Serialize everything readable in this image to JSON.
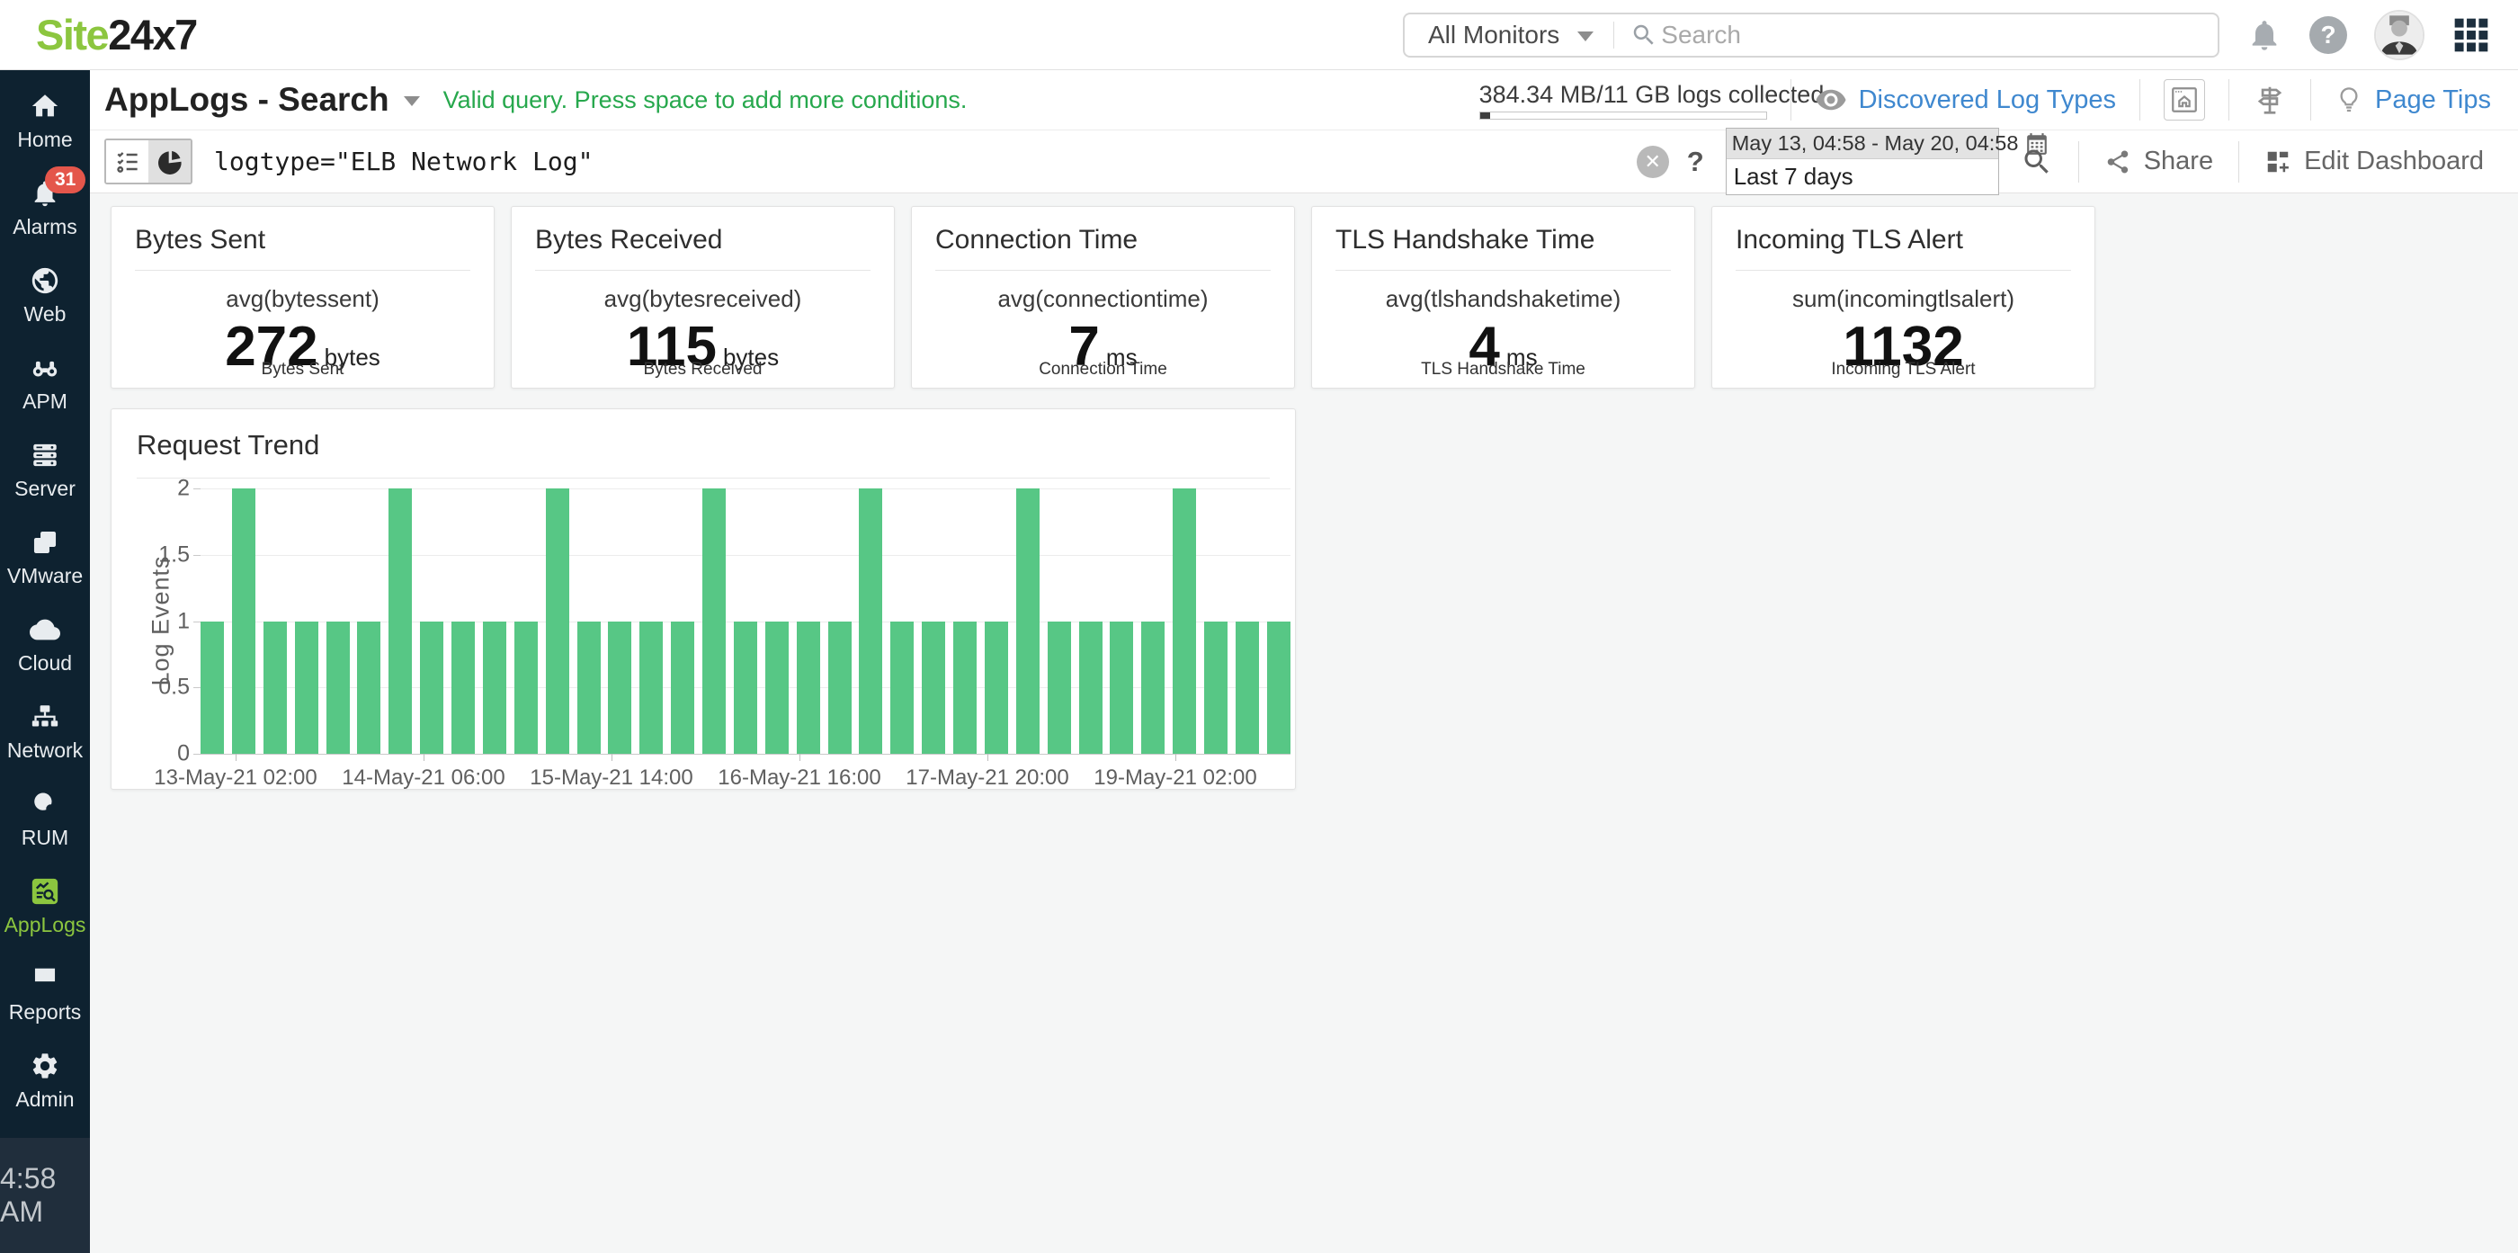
{
  "topbar": {
    "logo_part1": "Site",
    "logo_part2": "24x7",
    "monitor_dropdown": "All Monitors",
    "search_placeholder": "Search"
  },
  "sidebar": {
    "items": [
      {
        "label": "Home",
        "icon": "home"
      },
      {
        "label": "Alarms",
        "icon": "bell",
        "badge": "31"
      },
      {
        "label": "Web",
        "icon": "globe"
      },
      {
        "label": "APM",
        "icon": "binoculars"
      },
      {
        "label": "Server",
        "icon": "server"
      },
      {
        "label": "VMware",
        "icon": "vmware"
      },
      {
        "label": "Cloud",
        "icon": "cloud"
      },
      {
        "label": "Network",
        "icon": "network"
      },
      {
        "label": "RUM",
        "icon": "rum"
      },
      {
        "label": "AppLogs",
        "icon": "applogs",
        "active": true
      },
      {
        "label": "Reports",
        "icon": "reports"
      },
      {
        "label": "Admin",
        "icon": "admin"
      }
    ],
    "clock": "4:58 AM"
  },
  "header": {
    "title": "AppLogs - Search",
    "status_message": "Valid query. Press space to add more conditions.",
    "usage_text": "384.34 MB/11 GB logs collected",
    "usage_fill_percent": 3.5,
    "discovered_log_types": "Discovered Log Types",
    "page_tips": "Page Tips"
  },
  "querybar": {
    "query": "logtype=\"ELB Network Log\"",
    "clear_glyph": "✕",
    "help_glyph": "?",
    "date_range": "May 13, 04:58 - May 20, 04:58",
    "date_preset": "Last 7 days",
    "share_label": "Share",
    "edit_dashboard_label": "Edit Dashboard"
  },
  "cards": [
    {
      "title": "Bytes Sent",
      "metric": "avg(bytessent)",
      "value": "272",
      "unit": "bytes",
      "footer": "Bytes Sent"
    },
    {
      "title": "Bytes Received",
      "metric": "avg(bytesreceived)",
      "value": "115",
      "unit": "bytes",
      "footer": "Bytes Received"
    },
    {
      "title": "Connection Time",
      "metric": "avg(connectiontime)",
      "value": "7",
      "unit": "ms",
      "footer": "Connection Time"
    },
    {
      "title": "TLS Handshake Time",
      "metric": "avg(tlshandshaketime)",
      "value": "4",
      "unit": "ms",
      "footer": "TLS Handshake Time"
    },
    {
      "title": "Incoming TLS Alert",
      "metric": "sum(incomingtlsalert)",
      "value": "1132",
      "unit": "",
      "footer": "Incoming TLS Alert"
    }
  ],
  "chart_data": {
    "type": "bar",
    "title": "Request Trend",
    "ylabel": "Log Events",
    "ylim": [
      0,
      2
    ],
    "yticks": [
      0,
      0.5,
      1,
      1.5,
      2
    ],
    "grid": true,
    "legend": "none",
    "bar_color": "#57c785",
    "xtick_labels": [
      "13-May-21 02:00",
      "14-May-21 06:00",
      "15-May-21 14:00",
      "16-May-21 16:00",
      "17-May-21 20:00",
      "19-May-21 02:00"
    ],
    "values": [
      1,
      2,
      1,
      1,
      1,
      1,
      2,
      1,
      1,
      1,
      1,
      2,
      1,
      1,
      1,
      1,
      2,
      1,
      1,
      1,
      1,
      2,
      1,
      1,
      1,
      1,
      2,
      1,
      1,
      1,
      1,
      2,
      1,
      1,
      1
    ]
  },
  "colors": {
    "accent_green": "#8cc63f",
    "status_green": "#27a84d",
    "link_blue": "#3f88cf",
    "badge_red": "#e4564b",
    "sidebar_bg": "#0e2230",
    "bar_green": "#57c785"
  }
}
